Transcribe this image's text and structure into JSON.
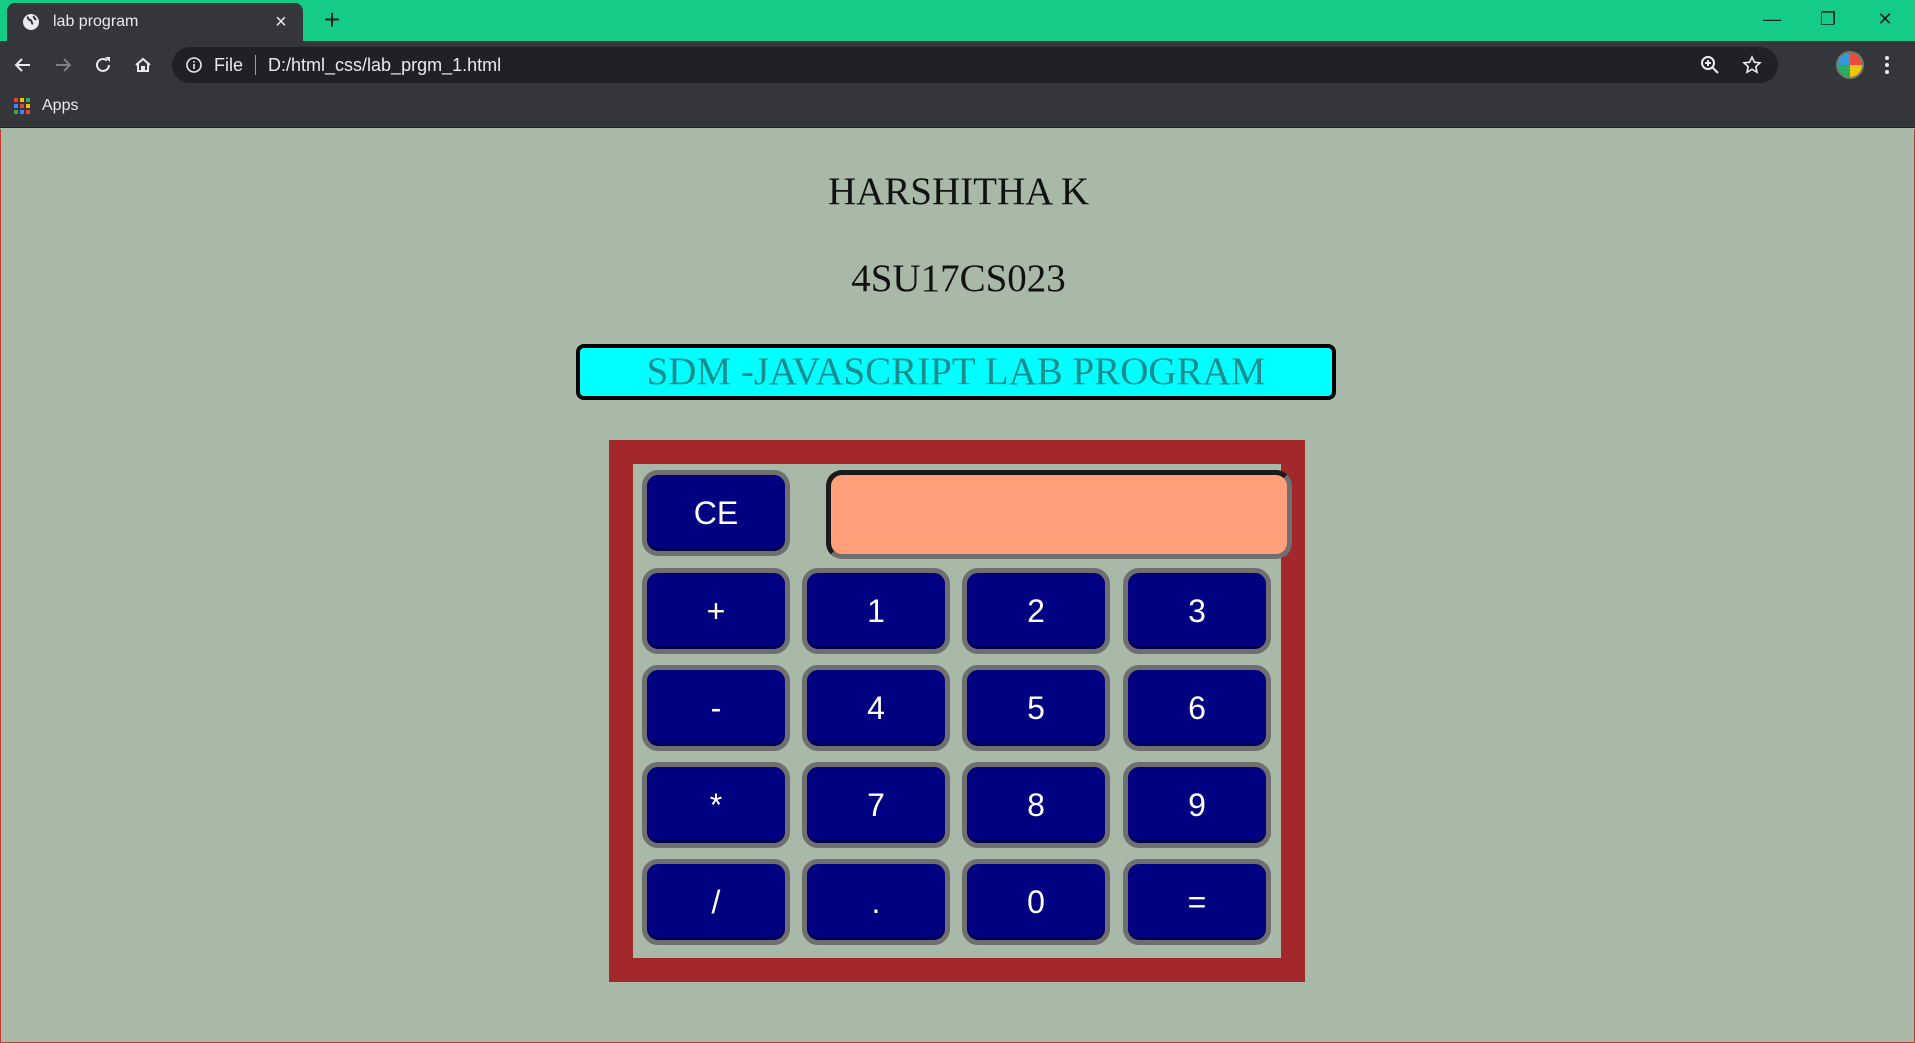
{
  "browser": {
    "tab_title": "lab program",
    "tab_close": "×",
    "new_tab": "+",
    "window_controls": {
      "minimize": "—",
      "restore": "❐",
      "close": "✕"
    },
    "address_scheme": "File",
    "address_url": "D:/html_css/lab_prgm_1.html",
    "bookmarks_apps_label": "Apps",
    "apps_colors": [
      "#ea4335",
      "#fbbc05",
      "#34a853",
      "#4285f4",
      "#ea4335",
      "#fbbc05",
      "#34a853",
      "#4285f4",
      "#ea4335"
    ]
  },
  "page": {
    "name": "HARSHITHA K",
    "usn": "4SU17CS023",
    "banner": "SDM -JAVASCRIPT LAB PROGRAM"
  },
  "calculator": {
    "display_value": "",
    "keys": {
      "clear": "CE",
      "plus": "+",
      "minus": "-",
      "multiply": "*",
      "divide": "/",
      "dot": ".",
      "equals": "=",
      "d0": "0",
      "d1": "1",
      "d2": "2",
      "d3": "3",
      "d4": "4",
      "d5": "5",
      "d6": "6",
      "d7": "7",
      "d8": "8",
      "d9": "9"
    },
    "colors": {
      "frame": "#a3282c",
      "key": "#000080",
      "display": "#ffa07a"
    }
  }
}
